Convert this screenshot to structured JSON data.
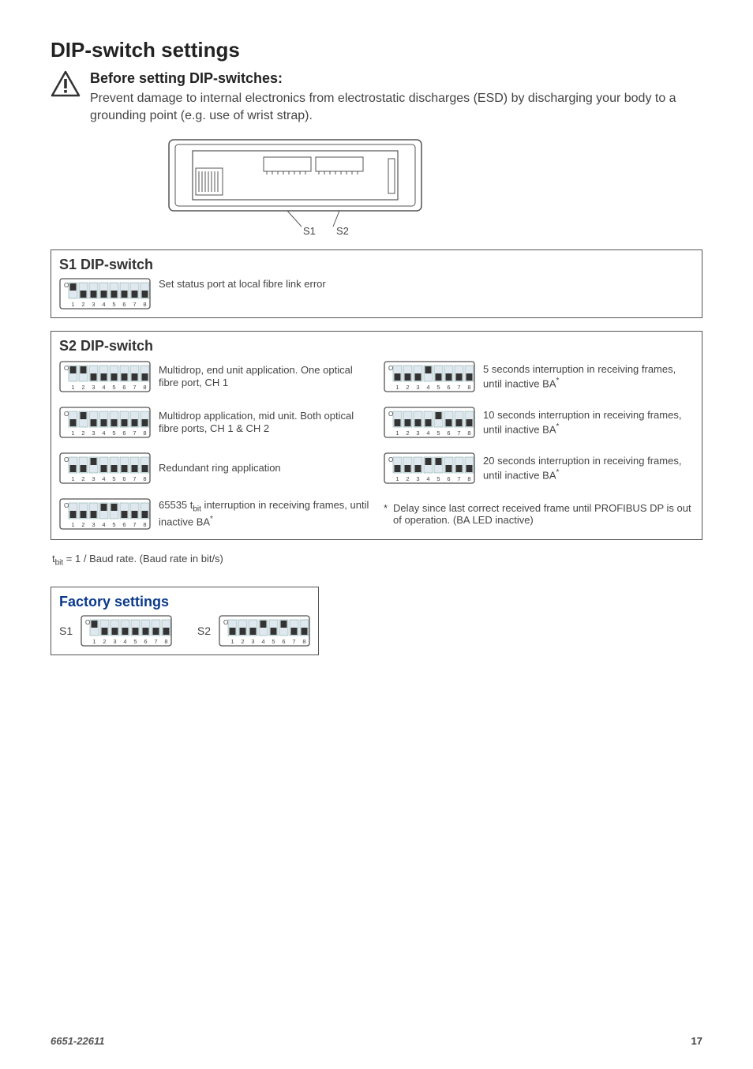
{
  "page": {
    "heading": "DIP-switch settings",
    "before_heading": "Before setting DIP-switches:",
    "before_body": "Prevent damage to internal electronics from electrostatic discharges (ESD) by discharging your body to a grounding point (e.g. use of wrist strap).",
    "s1_title": "S1 DIP-switch",
    "s1_desc": "Set status port at local fibre link error",
    "s2_title": "S2 DIP-switch",
    "s2_items": [
      "Multidrop, end unit application. One optical fibre port, CH 1",
      "Multidrop application, mid unit. Both optical fibre ports, CH 1 & CH 2",
      "Redundant ring application",
      "65535 tbit interruption in receiving frames, until inactive BA*",
      "5 seconds interruption in receiving frames, until inactive BA*",
      "10 seconds interruption in receiving frames, until inactive BA*",
      "20 seconds interruption in receiving frames, until inactive BA*"
    ],
    "footnote_ast": "*",
    "footnote_text": "Delay since last correct received frame until PROFIBUS DP is out of operation. (BA LED inactive)",
    "tbit_line": "tbit = 1 / Baud rate. (Baud rate in bit/s)",
    "factory_title": "Factory settings",
    "factory_s1_label": "S1",
    "factory_s2_label": "S2",
    "device_labels": {
      "s1": "S1",
      "s2": "S2"
    },
    "footer_doc": "6651-22611",
    "footer_page": "17",
    "dip_numbers": "1 2 3 4 5 6 7 8",
    "dip_on": "ON"
  },
  "dip_configs": {
    "s1_main": [
      1,
      0,
      0,
      0,
      0,
      0,
      0,
      0
    ],
    "s2_a": [
      1,
      1,
      0,
      0,
      0,
      0,
      0,
      0
    ],
    "s2_b": [
      0,
      1,
      0,
      0,
      0,
      0,
      0,
      0
    ],
    "s2_c": [
      0,
      0,
      1,
      0,
      0,
      0,
      0,
      0
    ],
    "s2_d": [
      0,
      0,
      0,
      1,
      1,
      0,
      0,
      0
    ],
    "s2_e": [
      0,
      0,
      0,
      1,
      0,
      0,
      0,
      0
    ],
    "s2_f": [
      0,
      0,
      0,
      0,
      1,
      0,
      0,
      0
    ],
    "s2_g": [
      0,
      0,
      0,
      1,
      1,
      0,
      0,
      0
    ],
    "fact_s1": [
      1,
      0,
      0,
      0,
      0,
      0,
      0,
      0
    ],
    "fact_s2": [
      0,
      0,
      0,
      1,
      0,
      1,
      0,
      0
    ]
  }
}
